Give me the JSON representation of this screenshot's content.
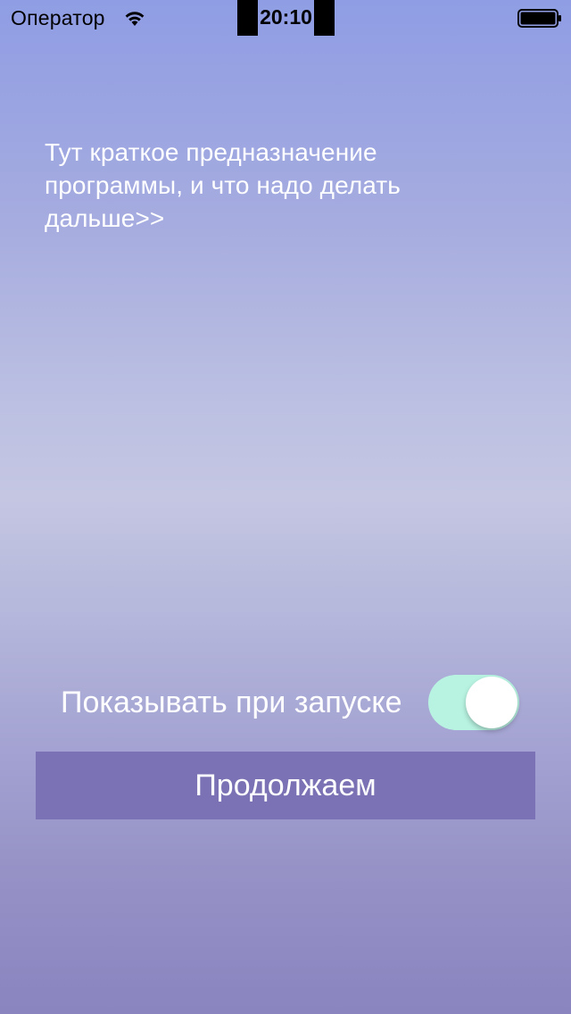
{
  "status_bar": {
    "carrier": "Оператор",
    "time": "20:10",
    "wifi_icon": "wifi-icon",
    "battery_icon": "battery-icon"
  },
  "main": {
    "description": "Тут краткое предназначение программы, и что надо делать дальше>>",
    "toggle": {
      "label": "Показывать при запуске",
      "on": true,
      "color": "#b8f3e1"
    },
    "continue_button": {
      "label": "Продолжаем",
      "color": "#7a72b4"
    }
  }
}
